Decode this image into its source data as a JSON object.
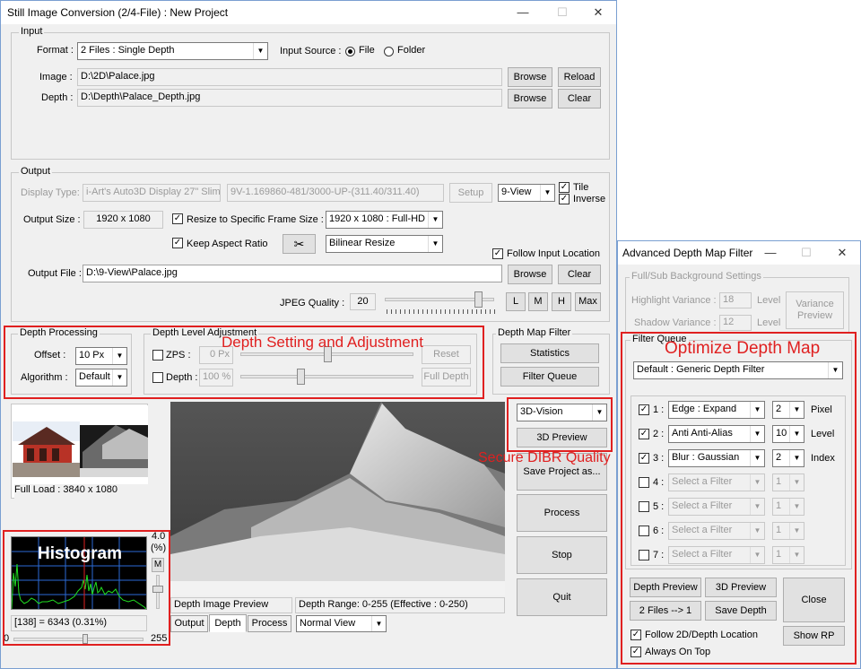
{
  "main": {
    "title": "Still Image Conversion (2/4-File) : New Project",
    "controls": {
      "min": "—",
      "max": "☐",
      "close": "✕"
    },
    "input": {
      "group": "Input",
      "format_label": "Format :",
      "format_value": "2 Files : Single Depth",
      "input_source_label": "Input Source :",
      "radio_file": "File",
      "radio_folder": "Folder",
      "image_label": "Image :",
      "image_path": "D:\\2D\\Palace.jpg",
      "depth_label": "Depth :",
      "depth_path": "D:\\Depth\\Palace_Depth.jpg",
      "browse": "Browse",
      "reload": "Reload",
      "clear": "Clear"
    },
    "output": {
      "group": "Output",
      "display_type_label": "Display Type:",
      "display_type_value": "i-Art's Auto3D Display 27\" Slim",
      "display_model": "9V-1.169860-481/3000-UP-(311.40/311.40)",
      "setup": "Setup",
      "view_value": "9-View",
      "tile": "Tile",
      "inverse": "Inverse",
      "output_size_label": "Output  Size :",
      "output_size_value": "1920 x 1080",
      "resize_label": "Resize  to Specific Frame Size :",
      "frame_size_value": "1920 x 1080  : Full-HD",
      "keep_aspect": "Keep Aspect Ratio",
      "resize_method": "Bilinear Resize",
      "follow_input": "Follow Input Location",
      "output_file_label": "Output File :",
      "output_file_path": "D:\\9-View\\Palace.jpg",
      "browse": "Browse",
      "clear": "Clear",
      "jpeg_quality_label": "JPEG Quality :",
      "jpeg_quality_value": "20",
      "jpeg_quality_fraction": 0.85,
      "l": "L",
      "m": "M",
      "h": "H",
      "max": "Max"
    },
    "depth_processing": {
      "group": "Depth Processing",
      "offset_label": "Offset  :",
      "offset_value": "10 Px",
      "algorithm_label": "Algorithm :",
      "algorithm_value": "Default"
    },
    "depth_level": {
      "group": "Depth Level Adjustment",
      "zps_label": "ZPS :",
      "zps_value": "0 Px",
      "reset": "Reset",
      "depth_label": "Depth :",
      "depth_value": "100 %",
      "full_depth": "Full Depth"
    },
    "depth_map_filter": {
      "group": "Depth Map Filter",
      "statistics": "Statistics",
      "filter_queue": "Filter Queue"
    },
    "preview": {
      "vision_value": "3D-Vision",
      "preview_3d": "3D Preview",
      "save_project": "Save Project as...",
      "process": "Process",
      "stop": "Stop",
      "quit": "Quit",
      "full_load": "Full Load : 3840 x 1080",
      "depth_image_preview": "Depth Image Preview",
      "depth_range": "Depth Range: 0-255  (Effective : 0-250)",
      "tab_output": "Output",
      "tab_depth": "Depth",
      "tab_process": "Process",
      "view_mode": "Normal View"
    },
    "histogram": {
      "scale_top": "4.0",
      "scale_unit": "(%)",
      "scale_mode": "M",
      "readout": "[138] = 6343 (0.31%)",
      "min": "0",
      "max": "255"
    }
  },
  "annotations": {
    "depth_setting": "Depth Setting and Adjustment",
    "secure_dibr": "Secure DIBR Quality",
    "histogram": "Histogram",
    "optimize": "Optimize Depth Map"
  },
  "filter_window": {
    "title": "Advanced Depth Map Filter",
    "controls": {
      "min": "—",
      "max": "☐",
      "close": "✕"
    },
    "bg_group": "Full/Sub Background Settings",
    "highlight_label": "Highlight Variance :",
    "highlight_value": "18",
    "shadow_label": "Shadow Variance :",
    "shadow_value": "12",
    "level": "Level",
    "variance_preview": "Variance Preview",
    "queue_group": "Filter Queue",
    "preset_value": "Default : Generic Depth Filter",
    "rows": [
      {
        "num": "1 :",
        "filter": "Edge : Expand",
        "value": "2",
        "unit": "Pixel",
        "checked": true
      },
      {
        "num": "2 :",
        "filter": "Anti Anti-Alias",
        "value": "10",
        "unit": "Level",
        "checked": true
      },
      {
        "num": "3 :",
        "filter": "Blur : Gaussian",
        "value": "2",
        "unit": "Index",
        "checked": true
      },
      {
        "num": "4 :",
        "filter": "Select a Filter",
        "value": "1",
        "unit": "",
        "checked": false
      },
      {
        "num": "5 :",
        "filter": "Select a Filter",
        "value": "1",
        "unit": "",
        "checked": false
      },
      {
        "num": "6 :",
        "filter": "Select a Filter",
        "value": "1",
        "unit": "",
        "checked": false
      },
      {
        "num": "7 :",
        "filter": "Select a Filter",
        "value": "1",
        "unit": "",
        "checked": false
      }
    ],
    "depth_preview": "Depth Preview",
    "preview_3d": "3D Preview",
    "close": "Close",
    "two_files": "2 Files --> 1",
    "save_depth": "Save Depth",
    "follow_location": "Follow 2D/Depth Location",
    "always_on_top": "Always On Top",
    "show_rp": "Show RP"
  }
}
